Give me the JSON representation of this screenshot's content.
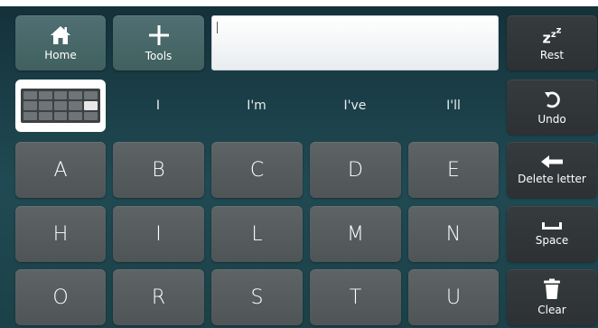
{
  "top_row": {
    "home_label": "Home",
    "tools_label": "Tools"
  },
  "text_field": {
    "value": ""
  },
  "predictions": [
    "I",
    "I'm",
    "I've",
    "I'll"
  ],
  "letters": {
    "row1": [
      "A",
      "B",
      "C",
      "D",
      "E"
    ],
    "row2": [
      "H",
      "I",
      "L",
      "M",
      "N"
    ],
    "row3": [
      "O",
      "R",
      "S",
      "T",
      "U"
    ]
  },
  "side": {
    "rest_label": "Rest",
    "undo_label": "Undo",
    "delete_label": "Delete letter",
    "space_label": "Space",
    "clear_label": "Clear"
  },
  "icons": {
    "home": "home-icon",
    "tools": "plus-icon",
    "rest": "zzz-icon",
    "undo": "undo-icon",
    "delete": "arrow-left-icon",
    "space": "space-icon",
    "clear": "trash-icon",
    "keyboard": "keyboard-icon"
  },
  "colors": {
    "background": "#1f454d",
    "key": "#565c5e",
    "key_teal": "#48676a",
    "key_dark": "#313638",
    "text": "#ffffff"
  }
}
